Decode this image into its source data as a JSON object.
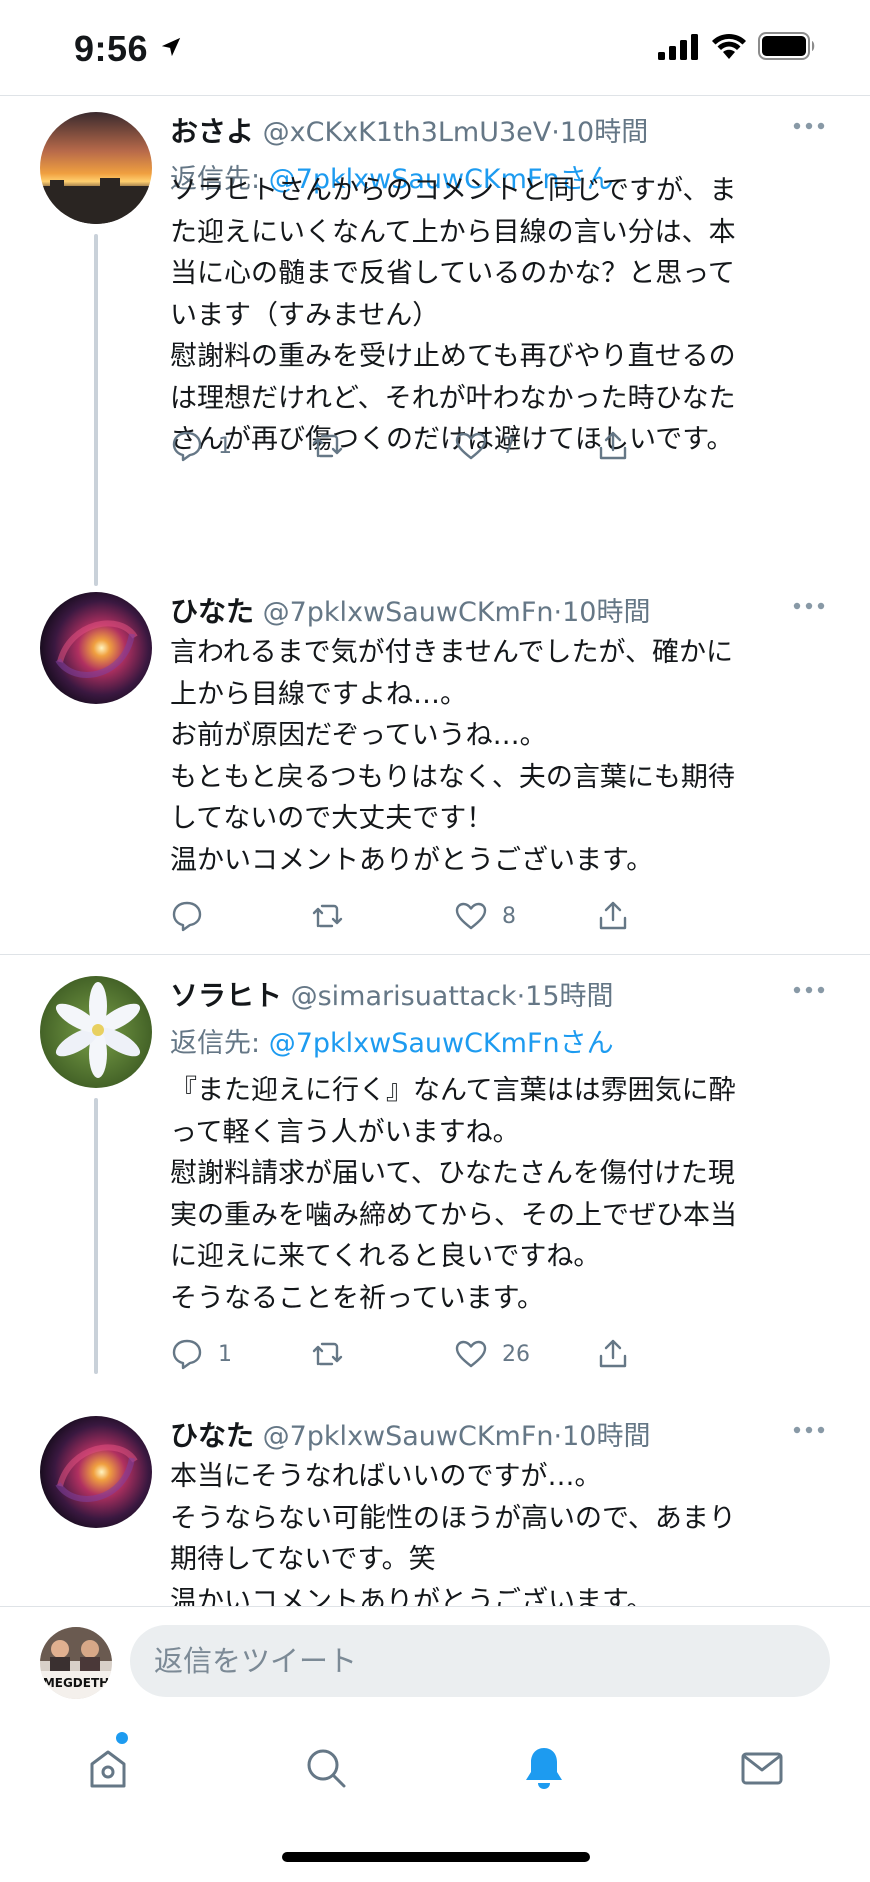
{
  "status_bar": {
    "time": "9:56"
  },
  "tweets": [
    {
      "name": "おさよ",
      "handle": "@xCKxK1th3LmU3eV",
      "dot": "·",
      "time": "10時間",
      "reply_prefix": "返信先: ",
      "reply_handle": "@7pklxwSauwCKmFnさん",
      "body": "ソラヒトさんからのコメントと同じですが、ま\nた迎えにいくなんて上から目線の言い分は、本\n当に心の髄まで反省しているのかな？と思って\nいます（すみません）\n慰謝料の重みを受け止めても再びやり直せるの\nは理想だけれど、それが叶わなかった時ひなた\nさんが再び傷つくのだけは避けてほしいです。",
      "reply_count": "1",
      "retweet_count": "",
      "like_count": "7"
    },
    {
      "name": "ひなた",
      "handle": "@7pklxwSauwCKmFn",
      "dot": "·",
      "time": "10時間",
      "body": "言われるまで気が付きませんでしたが、確かに\n上から目線ですよね…。\nお前が原因だぞっていうね…。\nもともと戻るつもりはなく、夫の言葉にも期待\nしてないので大丈夫です！\n温かいコメントありがとうございます。",
      "reply_count": "",
      "retweet_count": "",
      "like_count": "8"
    },
    {
      "name": "ソラヒト",
      "handle": "@simarisuattack",
      "dot": "·",
      "time": "15時間",
      "reply_prefix": "返信先: ",
      "reply_handle": "@7pklxwSauwCKmFnさん",
      "body": "『また迎えに行く』なんて言葉はは雰囲気に酔\nって軽く言う人がいますね。\n慰謝料請求が届いて、ひなたさんを傷付けた現\n実の重みを噛み締めてから、その上でぜひ本当\nに迎えに来てくれると良いですね。\nそうなることを祈っています。",
      "reply_count": "1",
      "retweet_count": "",
      "like_count": "26"
    },
    {
      "name": "ひなた",
      "handle": "@7pklxwSauwCKmFn",
      "dot": "·",
      "time": "10時間",
      "body": "本当にそうなればいいのですが…。\nそうならない可能性のほうが高いので、あまり\n期待してないです。笑\n温かいコメントありがとうございます。"
    }
  ],
  "compose": {
    "placeholder": "返信をツイート",
    "avatar_text": "MEGDETH"
  },
  "tab_bar": {
    "icons": [
      "home-icon",
      "search-icon",
      "notifications-icon",
      "messages-icon"
    ],
    "active": "notifications-icon"
  },
  "colors": {
    "accent": "#1d9bf0",
    "secondary_text": "#657786",
    "divider": "#dfe3e7",
    "thread_line": "#c9d1d9"
  }
}
